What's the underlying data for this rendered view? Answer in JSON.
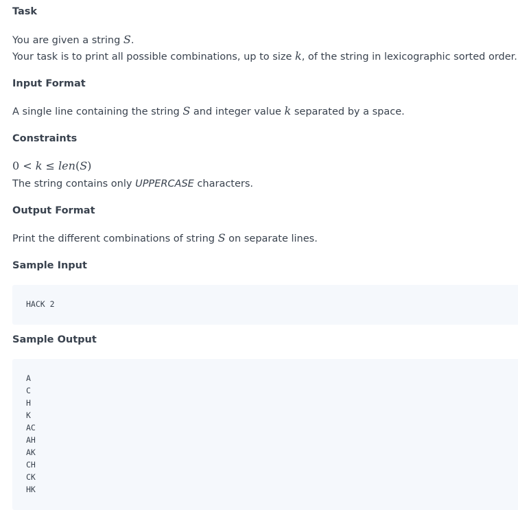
{
  "sections": {
    "task": {
      "heading": "Task",
      "line1_prefix": "You are given a string ",
      "line1_var": "S",
      "line1_suffix": ".",
      "line2_prefix": "Your task is to print all possible combinations, up to size ",
      "line2_var": "k",
      "line2_suffix": ", of the string in lexicographic sorted order."
    },
    "input_format": {
      "heading": "Input Format",
      "text_prefix": "A single line containing the string ",
      "text_var1": "S",
      "text_mid": " and integer value ",
      "text_var2": "k",
      "text_suffix": " separated by a space."
    },
    "constraints": {
      "heading": "Constraints",
      "formula_0": "0",
      "formula_lt": " < ",
      "formula_k": "k",
      "formula_le": " ≤ ",
      "formula_len": "len",
      "formula_open": "(",
      "formula_S": "S",
      "formula_close": ")",
      "text_prefix": "The string contains only ",
      "text_em": "UPPERCASE",
      "text_suffix": " characters."
    },
    "output_format": {
      "heading": "Output Format",
      "text_prefix": "Print the different combinations of string ",
      "text_var": "S",
      "text_suffix": " on separate lines."
    },
    "sample_input": {
      "heading": "Sample Input",
      "code": "HACK 2"
    },
    "sample_output": {
      "heading": "Sample Output",
      "lines": [
        "A",
        "C",
        "H",
        "K",
        "AC",
        "AH",
        "AK",
        "CH",
        "CK",
        "HK"
      ]
    }
  },
  "colors": {
    "text": "#39424e",
    "code_background": "#f5f8fc"
  }
}
